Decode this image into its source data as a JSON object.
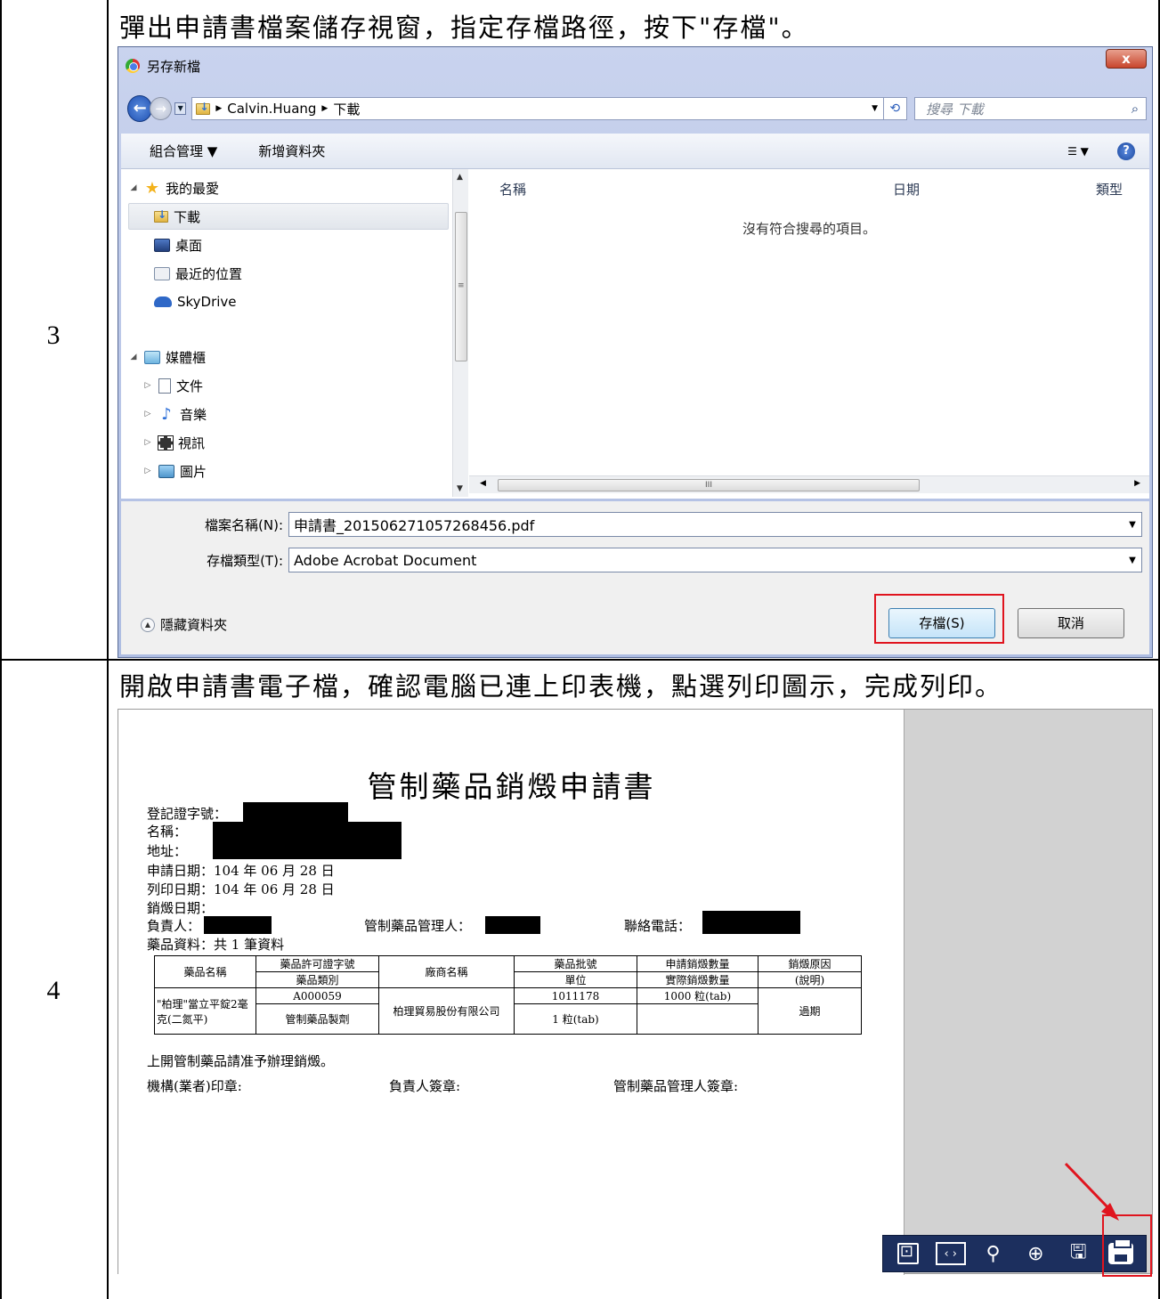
{
  "rows": [
    {
      "step": "3",
      "caption": "彈出申請書檔案儲存視窗，指定存檔路徑，按下\"存檔\"。"
    },
    {
      "step": "4",
      "caption": "開啟申請書電子檔，確認電腦已連上印表機，點選列印圖示，完成列印。"
    }
  ],
  "save_dialog": {
    "title": "另存新檔",
    "close_label": "x",
    "breadcrumb": [
      "Calvin.Huang",
      "下載"
    ],
    "search_placeholder": "搜尋 下載",
    "toolbar": {
      "organize": "組合管理 ▼",
      "new_folder": "新增資料夾"
    },
    "tree": {
      "favorites": "我的最愛",
      "downloads": "下載",
      "desktop": "桌面",
      "recent": "最近的位置",
      "skydrive": "SkyDrive",
      "libraries": "媒體櫃",
      "documents": "文件",
      "music": "音樂",
      "videos": "視訊",
      "pictures": "圖片"
    },
    "columns": [
      "名稱",
      "日期",
      "類型"
    ],
    "empty_message": "沒有符合搜尋的項目。",
    "filename_label": "檔案名稱(N):",
    "filename_value": "申請書_201506271057268456.pdf",
    "filetype_label": "存檔類型(T):",
    "filetype_value": "Adobe Acrobat Document",
    "hide_folders": "隱藏資料夾",
    "save_button": "存檔(S)",
    "cancel_button": "取消"
  },
  "pdf": {
    "title": "管制藥品銷燬申請書",
    "reg_no_label": "登記證字號：",
    "name_label": "名稱：",
    "address_label": "地址：",
    "apply_date": "申請日期：104 年 06 月 28 日",
    "print_date": "列印日期：104 年 06 月 28 日",
    "destroy_date": "銷燬日期：",
    "owner_label": "負責人：",
    "manager_label": "管制藥品管理人：",
    "phone_label": "聯絡電話：",
    "drug_info": "藥品資料：共 1 筆資料",
    "table": {
      "h_name": "藥品名稱",
      "h_permit": "藥品許可證字號",
      "h_class": "藥品類別",
      "h_maker": "廠商名稱",
      "h_batch": "藥品批號",
      "h_unit": "單位",
      "h_apply_qty": "申請銷燬數量",
      "h_actual_qty": "實際銷燬數量",
      "h_reason": "銷燬原因",
      "h_reason_note": "(說明)",
      "drug_name": "\"柏理\"當立平錠2毫克(二氮平)",
      "permit": "A000059",
      "class": "管制藥品製劑",
      "maker": "柏理貿易股份有限公司",
      "batch": "1011178",
      "unit": "1 粒(tab)",
      "apply_qty": "1000 粒(tab)",
      "actual_qty": "",
      "reason": "過期"
    },
    "footer_note": "上開管制藥品請准予辦理銷燬。",
    "sig_org": "機構(業者)印章:",
    "sig_owner": "負責人簽章:",
    "sig_manager": "管制藥品管理人簽章:"
  },
  "viewer_toolbar": [
    "fit-page",
    "fit-width",
    "zoom-out",
    "zoom-in",
    "save",
    "print"
  ],
  "colors": {
    "highlight": "#e0141e",
    "viewer_toolbar_bg": "#1c2f5e"
  }
}
